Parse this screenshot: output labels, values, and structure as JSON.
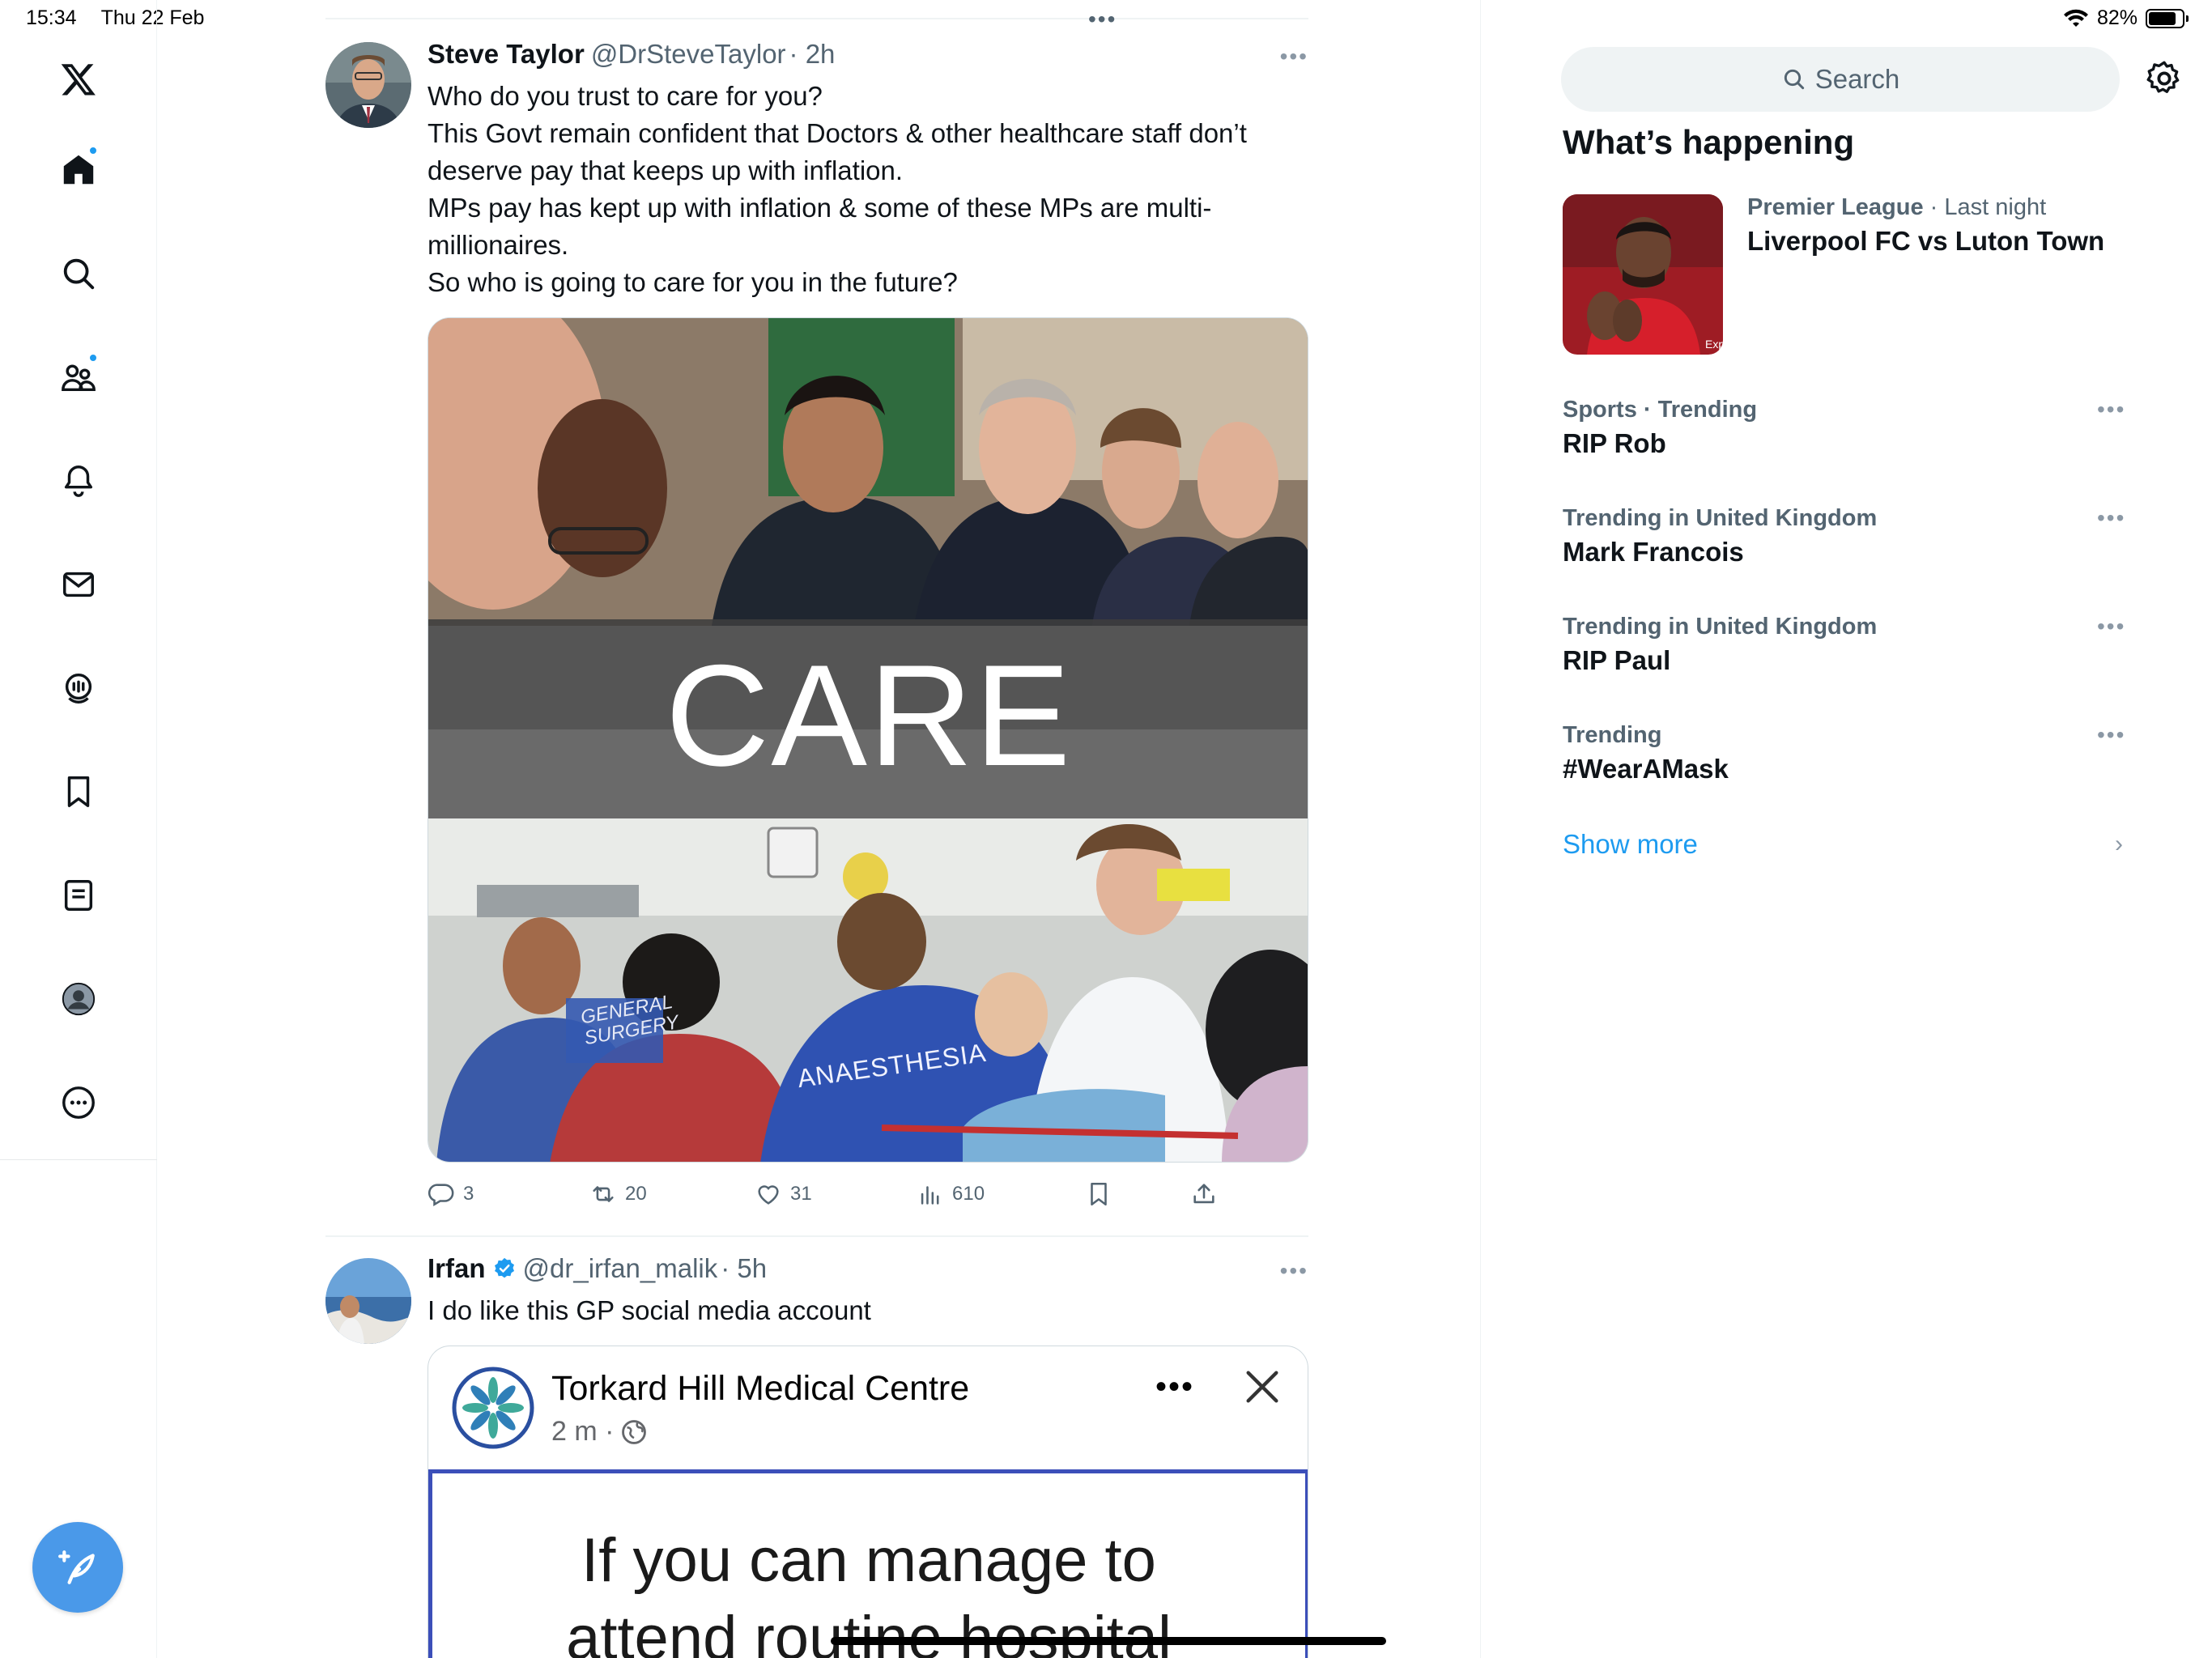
{
  "status_bar": {
    "time": "15:34",
    "date": "Thu 22 Feb",
    "battery": "82%"
  },
  "nav": {
    "items": [
      "x-logo",
      "home",
      "search",
      "communities",
      "notifications",
      "messages",
      "spaces",
      "bookmarks",
      "lists",
      "profile",
      "more"
    ]
  },
  "tweets": [
    {
      "name": "Steve Taylor",
      "handle": "@DrSteveTaylor",
      "time": "· 2h",
      "text_lines": [
        "Who do you trust to care for you?",
        "This Govt remain confident that Doctors & other healthcare staff don’t",
        "deserve pay that keeps up with inflation.",
        "MPs pay has kept up with inflation & some of these MPs are multi-",
        "millionaires.",
        "So who is going to care for you in the future?"
      ],
      "image_caption": "CARE",
      "image_labels": {
        "left_tunic": "GENERAL SURGERY",
        "center_tunic": "ANAESTHESIA"
      },
      "stats": {
        "replies": "3",
        "reposts": "20",
        "likes": "31",
        "views": "610"
      }
    },
    {
      "name": "Irfan",
      "handle": "@dr_irfan_malik",
      "time": "· 5h",
      "text": "I do like this GP social media account",
      "embedded": {
        "page_name": "Torkard Hill Medical Centre",
        "meta": "2 m ·",
        "post_text_lines": [
          "If you can manage to",
          "attend routine hospital"
        ]
      }
    }
  ],
  "sidebar": {
    "search_placeholder": "Search",
    "section_title": "What’s happening",
    "featured": {
      "category": "Premier League",
      "time": "· Last night",
      "title": "Liverpool FC vs Luton Town",
      "thumb_text": "Expe"
    },
    "trends": [
      {
        "meta": "Sports · Trending",
        "title": "RIP Rob"
      },
      {
        "meta": "Trending in United Kingdom",
        "title": "Mark Francois"
      },
      {
        "meta": "Trending in United Kingdom",
        "title": "RIP Paul"
      },
      {
        "meta": "Trending",
        "title": "#WearAMask"
      }
    ],
    "show_more": "Show more"
  },
  "colors": {
    "accent": "#1d9bf0",
    "secondary_text": "#536471",
    "compose_fab": "#4a99e9"
  }
}
